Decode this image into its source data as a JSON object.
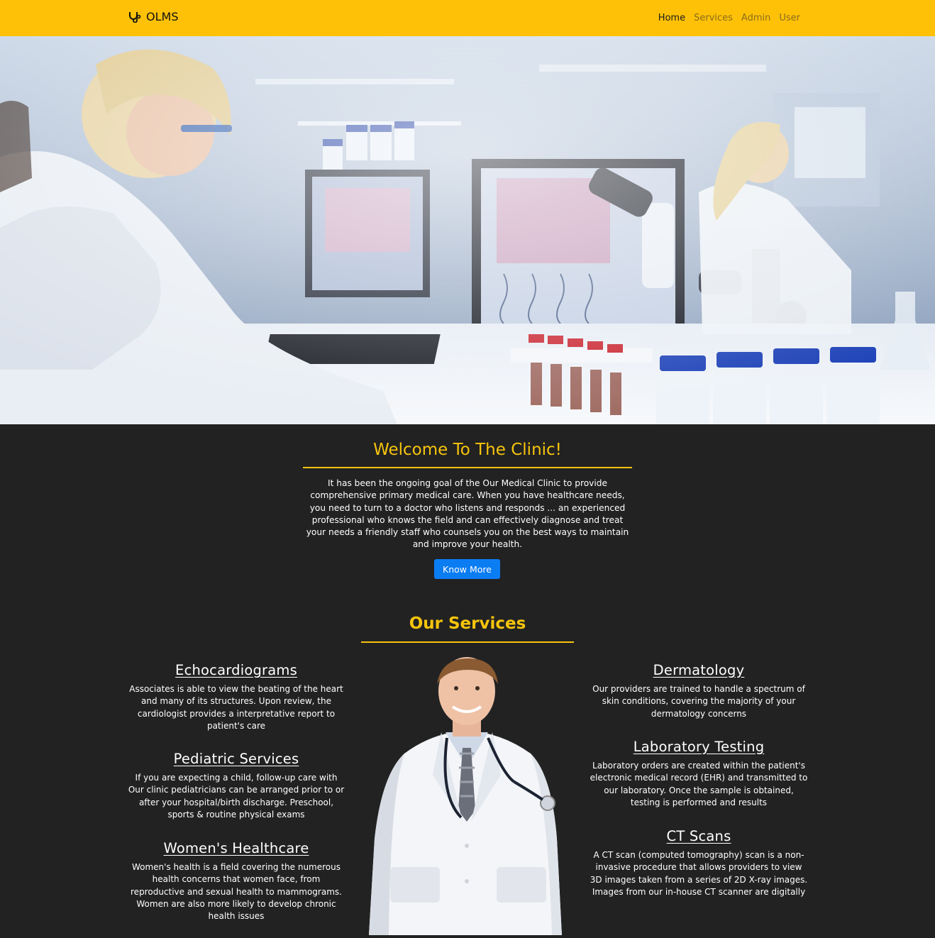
{
  "navbar": {
    "brand": "OLMS",
    "brand_icon": "stethoscope-icon",
    "links": [
      "Home",
      "Services",
      "Admin",
      "User"
    ],
    "active_link": "Home",
    "bg_color": "#fec107"
  },
  "hero": {
    "image": "laboratory-researchers-photo"
  },
  "welcome": {
    "title": "Welcome To The Clinic!",
    "text": "It has been the ongoing goal of the Our Medical Clinic to provide comprehensive primary medical care. When you have healthcare needs, you need to turn to a doctor who listens and responds ... an experienced professional who knows the field and can effectively diagnose and treat your needs a friendly staff who counsels you on the best ways to maintain and improve your health.",
    "button": "Know More"
  },
  "services": {
    "title": "Our Services",
    "items": [
      {
        "title": "Echocardiograms",
        "text": "Associates is able to view the beating of the heart and many of its structures. Upon review, the cardiologist provides a interpretative report to patient's care"
      },
      {
        "title": "Pediatric Services",
        "text": "If you are expecting a child, follow-up care with Our clinic pediatricians can be arranged prior to or after your hospital/birth discharge. Preschool, sports & routine physical exams"
      },
      {
        "title": "Women's Healthcare",
        "text": "Women's health is a field covering the numerous health concerns that women face, from reproductive and sexual health to mammograms. Women are also more likely to develop chronic health issues"
      },
      {
        "title": "Dermatology",
        "text": "Our providers are trained to handle a spectrum of skin conditions, covering the majority of your dermatology concerns"
      },
      {
        "title": "Laboratory Testing",
        "text": "Laboratory orders are created within the patient's electronic medical record (EHR) and transmitted to our laboratory. Once the sample is obtained, testing is performed and results"
      },
      {
        "title": "CT Scans",
        "text": "A CT scan (computed tomography) scan is a non-invasive procedure that allows providers to view 3D images taken from a series of 2D X-ray images. Images from our in-house CT scanner are digitally"
      }
    ]
  },
  "colors": {
    "accent": "#f6c40c",
    "dark_bg": "#222222",
    "button": "#0b7df3"
  }
}
